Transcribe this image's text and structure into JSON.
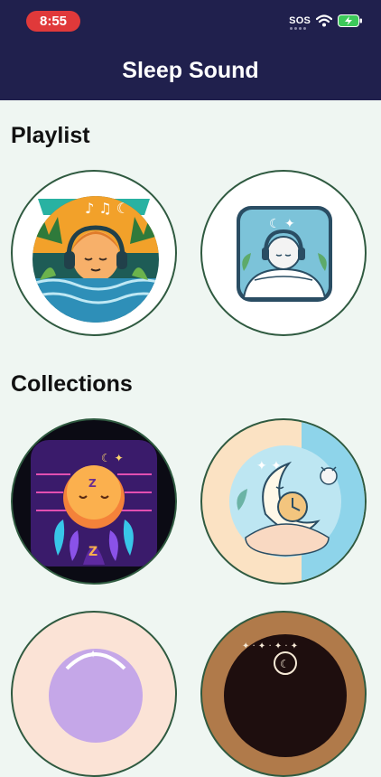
{
  "status_bar": {
    "time": "8:55",
    "sos": "SOS"
  },
  "header": {
    "title": "Sleep Sound"
  },
  "sections": {
    "playlist": {
      "title": "Playlist"
    },
    "collections": {
      "title": "Collections"
    }
  },
  "colors": {
    "header_bg": "#20204D",
    "page_bg": "#EFF6F2",
    "card_border": "#2F5A40",
    "time_pill": "#E0393A"
  }
}
